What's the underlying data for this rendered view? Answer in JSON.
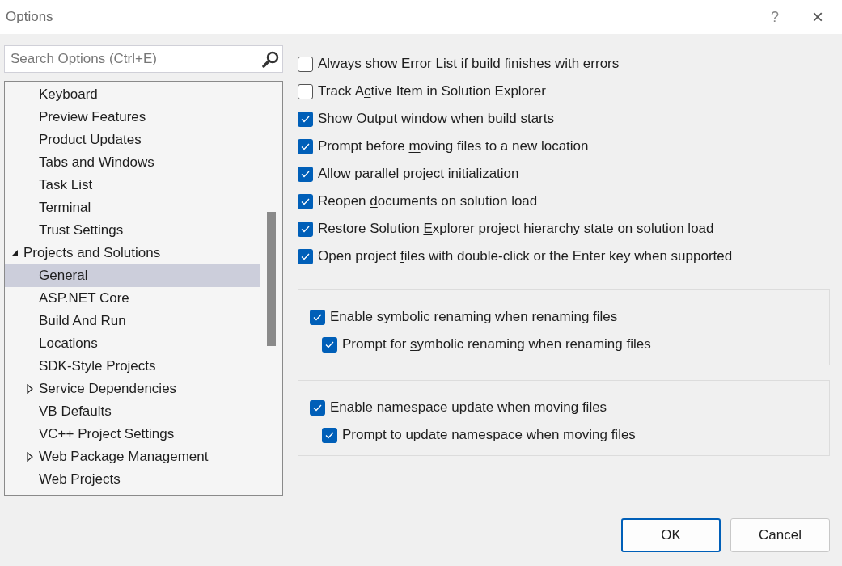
{
  "window": {
    "title": "Options",
    "help": "?",
    "close": "×"
  },
  "search": {
    "placeholder": "Search Options (Ctrl+E)"
  },
  "tree": {
    "items": [
      {
        "kind": "leaf",
        "label": "Keyboard",
        "selected": false
      },
      {
        "kind": "leaf",
        "label": "Preview Features",
        "selected": false
      },
      {
        "kind": "leaf",
        "label": "Product Updates",
        "selected": false
      },
      {
        "kind": "leaf",
        "label": "Tabs and Windows",
        "selected": false
      },
      {
        "kind": "leaf",
        "label": "Task List",
        "selected": false
      },
      {
        "kind": "leaf",
        "label": "Terminal",
        "selected": false
      },
      {
        "kind": "leaf",
        "label": "Trust Settings",
        "selected": false
      },
      {
        "kind": "branch",
        "label": "Projects and Solutions",
        "selected": false,
        "expanded": true,
        "children": [
          {
            "kind": "leaf",
            "label": "General",
            "selected": true
          },
          {
            "kind": "leaf",
            "label": "ASP.NET Core",
            "selected": false
          },
          {
            "kind": "leaf",
            "label": "Build And Run",
            "selected": false
          },
          {
            "kind": "leaf",
            "label": "Locations",
            "selected": false
          },
          {
            "kind": "leaf",
            "label": "SDK-Style Projects",
            "selected": false
          },
          {
            "kind": "branch",
            "label": "Service Dependencies",
            "selected": false,
            "expanded": false
          },
          {
            "kind": "leaf",
            "label": "VB Defaults",
            "selected": false
          },
          {
            "kind": "leaf",
            "label": "VC++ Project Settings",
            "selected": false
          },
          {
            "kind": "branch",
            "label": "Web Package Management",
            "selected": false,
            "expanded": false
          },
          {
            "kind": "leaf",
            "label": "Web Projects",
            "selected": false
          }
        ]
      }
    ]
  },
  "options": [
    {
      "label": [
        "Always show Error Lis",
        "t",
        " if build finishes with errors"
      ],
      "checked": false
    },
    {
      "label": [
        "Track A",
        "c",
        "tive Item in Solution Explorer"
      ],
      "checked": false
    },
    {
      "label": [
        "Show ",
        "O",
        "utput window when build starts"
      ],
      "checked": true
    },
    {
      "label": [
        "Prompt before ",
        "m",
        "oving files to a new location"
      ],
      "checked": true
    },
    {
      "label": [
        "Allow parallel ",
        "p",
        "roject initialization"
      ],
      "checked": true
    },
    {
      "label": [
        "Reopen ",
        "d",
        "ocuments on solution load"
      ],
      "checked": true
    },
    {
      "label": [
        "Restore Solution ",
        "E",
        "xplorer project hierarchy state on solution load"
      ],
      "checked": true
    },
    {
      "label": [
        "Open project ",
        "f",
        "iles with double-click or the Enter key when supported"
      ],
      "checked": true
    }
  ],
  "groups": [
    {
      "option": {
        "label": [
          "Enable symbolic renaming when renaming files"
        ],
        "checked": true
      },
      "sub_option": {
        "label": [
          "Prompt for ",
          "s",
          "ymbolic renaming when renaming files"
        ],
        "checked": true
      }
    },
    {
      "option": {
        "label": [
          "Enable namespace update when moving files"
        ],
        "checked": true
      },
      "sub_option": {
        "label": [
          "Prompt to update namespace when moving files"
        ],
        "checked": true
      }
    }
  ],
  "buttons": [
    {
      "label": "OK",
      "focused": true
    },
    {
      "label": "Cancel",
      "focused": false
    }
  ]
}
